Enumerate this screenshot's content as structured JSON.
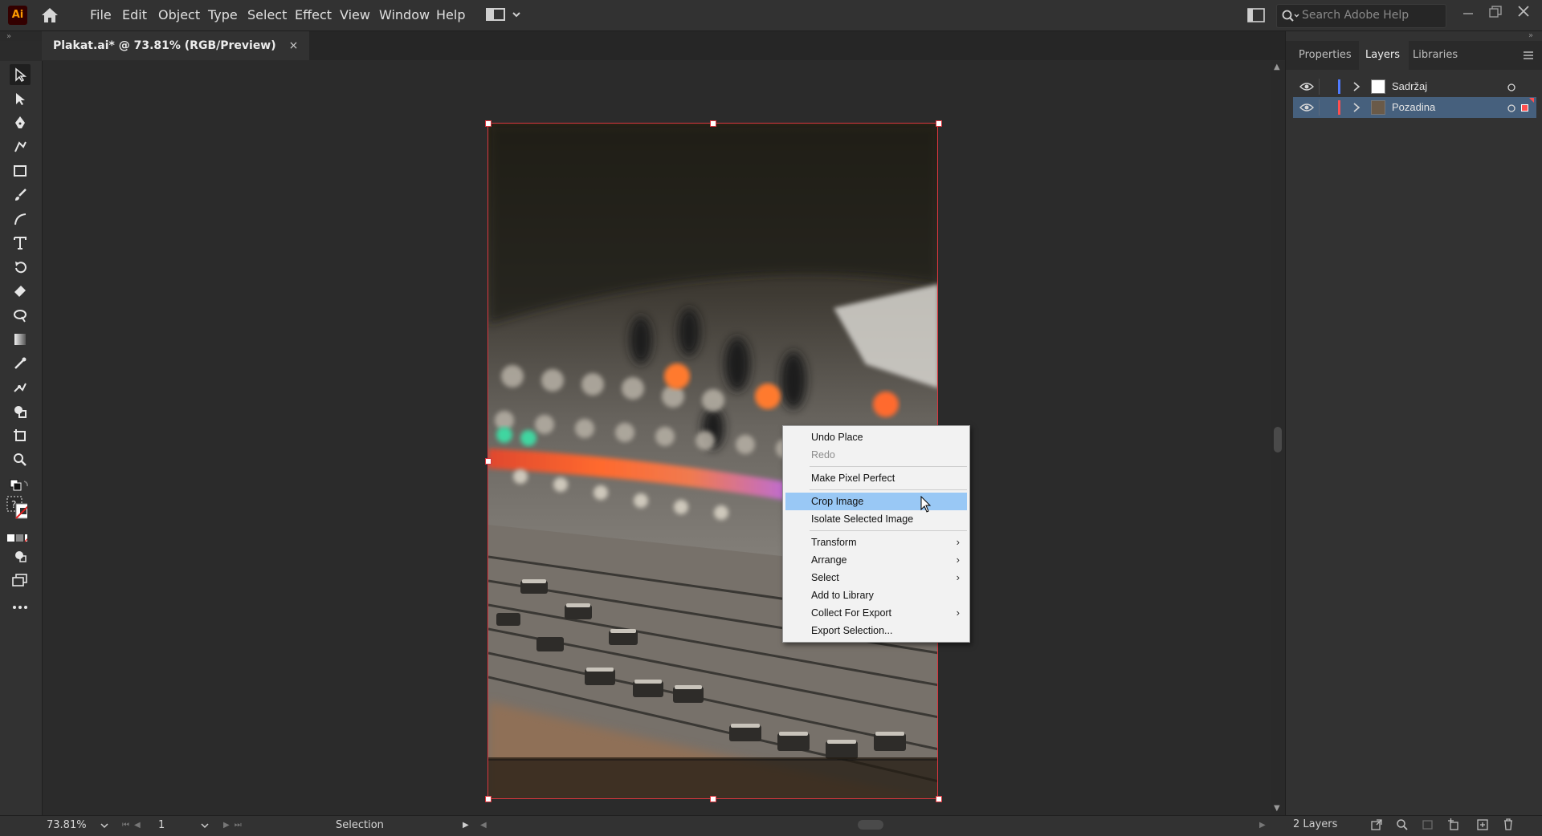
{
  "app": {
    "logo": "Ai"
  },
  "menubar": {
    "items": [
      "File",
      "Edit",
      "Object",
      "Type",
      "Select",
      "Effect",
      "View",
      "Window",
      "Help"
    ],
    "search_placeholder": "Search Adobe Help"
  },
  "document": {
    "tab_title": "Plakat.ai* @ 73.81% (RGB/Preview)",
    "close_glyph": "×"
  },
  "context_menu": {
    "items": [
      {
        "label": "Undo Place"
      },
      {
        "label": "Redo",
        "disabled": true
      },
      {
        "label": "Make Pixel Perfect"
      },
      {
        "label": "Crop Image",
        "highlighted": true
      },
      {
        "label": "Isolate Selected Image"
      },
      {
        "label": "Transform",
        "submenu": true
      },
      {
        "label": "Arrange",
        "submenu": true
      },
      {
        "label": "Select",
        "submenu": true
      },
      {
        "label": "Add to Library"
      },
      {
        "label": "Collect For Export",
        "submenu": true
      },
      {
        "label": "Export Selection..."
      }
    ],
    "submenu_glyph": "›"
  },
  "panel": {
    "tabs": [
      "Properties",
      "Layers",
      "Libraries"
    ],
    "active_tab": "Layers",
    "layers": [
      {
        "name": "Sadržaj",
        "color": "#4f7bff",
        "selected": false
      },
      {
        "name": "Pozadina",
        "color": "#ff4f4f",
        "selected": true
      }
    ],
    "layer_count": "2 Layers"
  },
  "status": {
    "zoom": "73.81%",
    "page": "1",
    "tool": "Selection"
  },
  "colors": {
    "accent_selection": "#46607d",
    "menu_highlight": "#99c8f5",
    "artboard_border": "#d9363e"
  }
}
